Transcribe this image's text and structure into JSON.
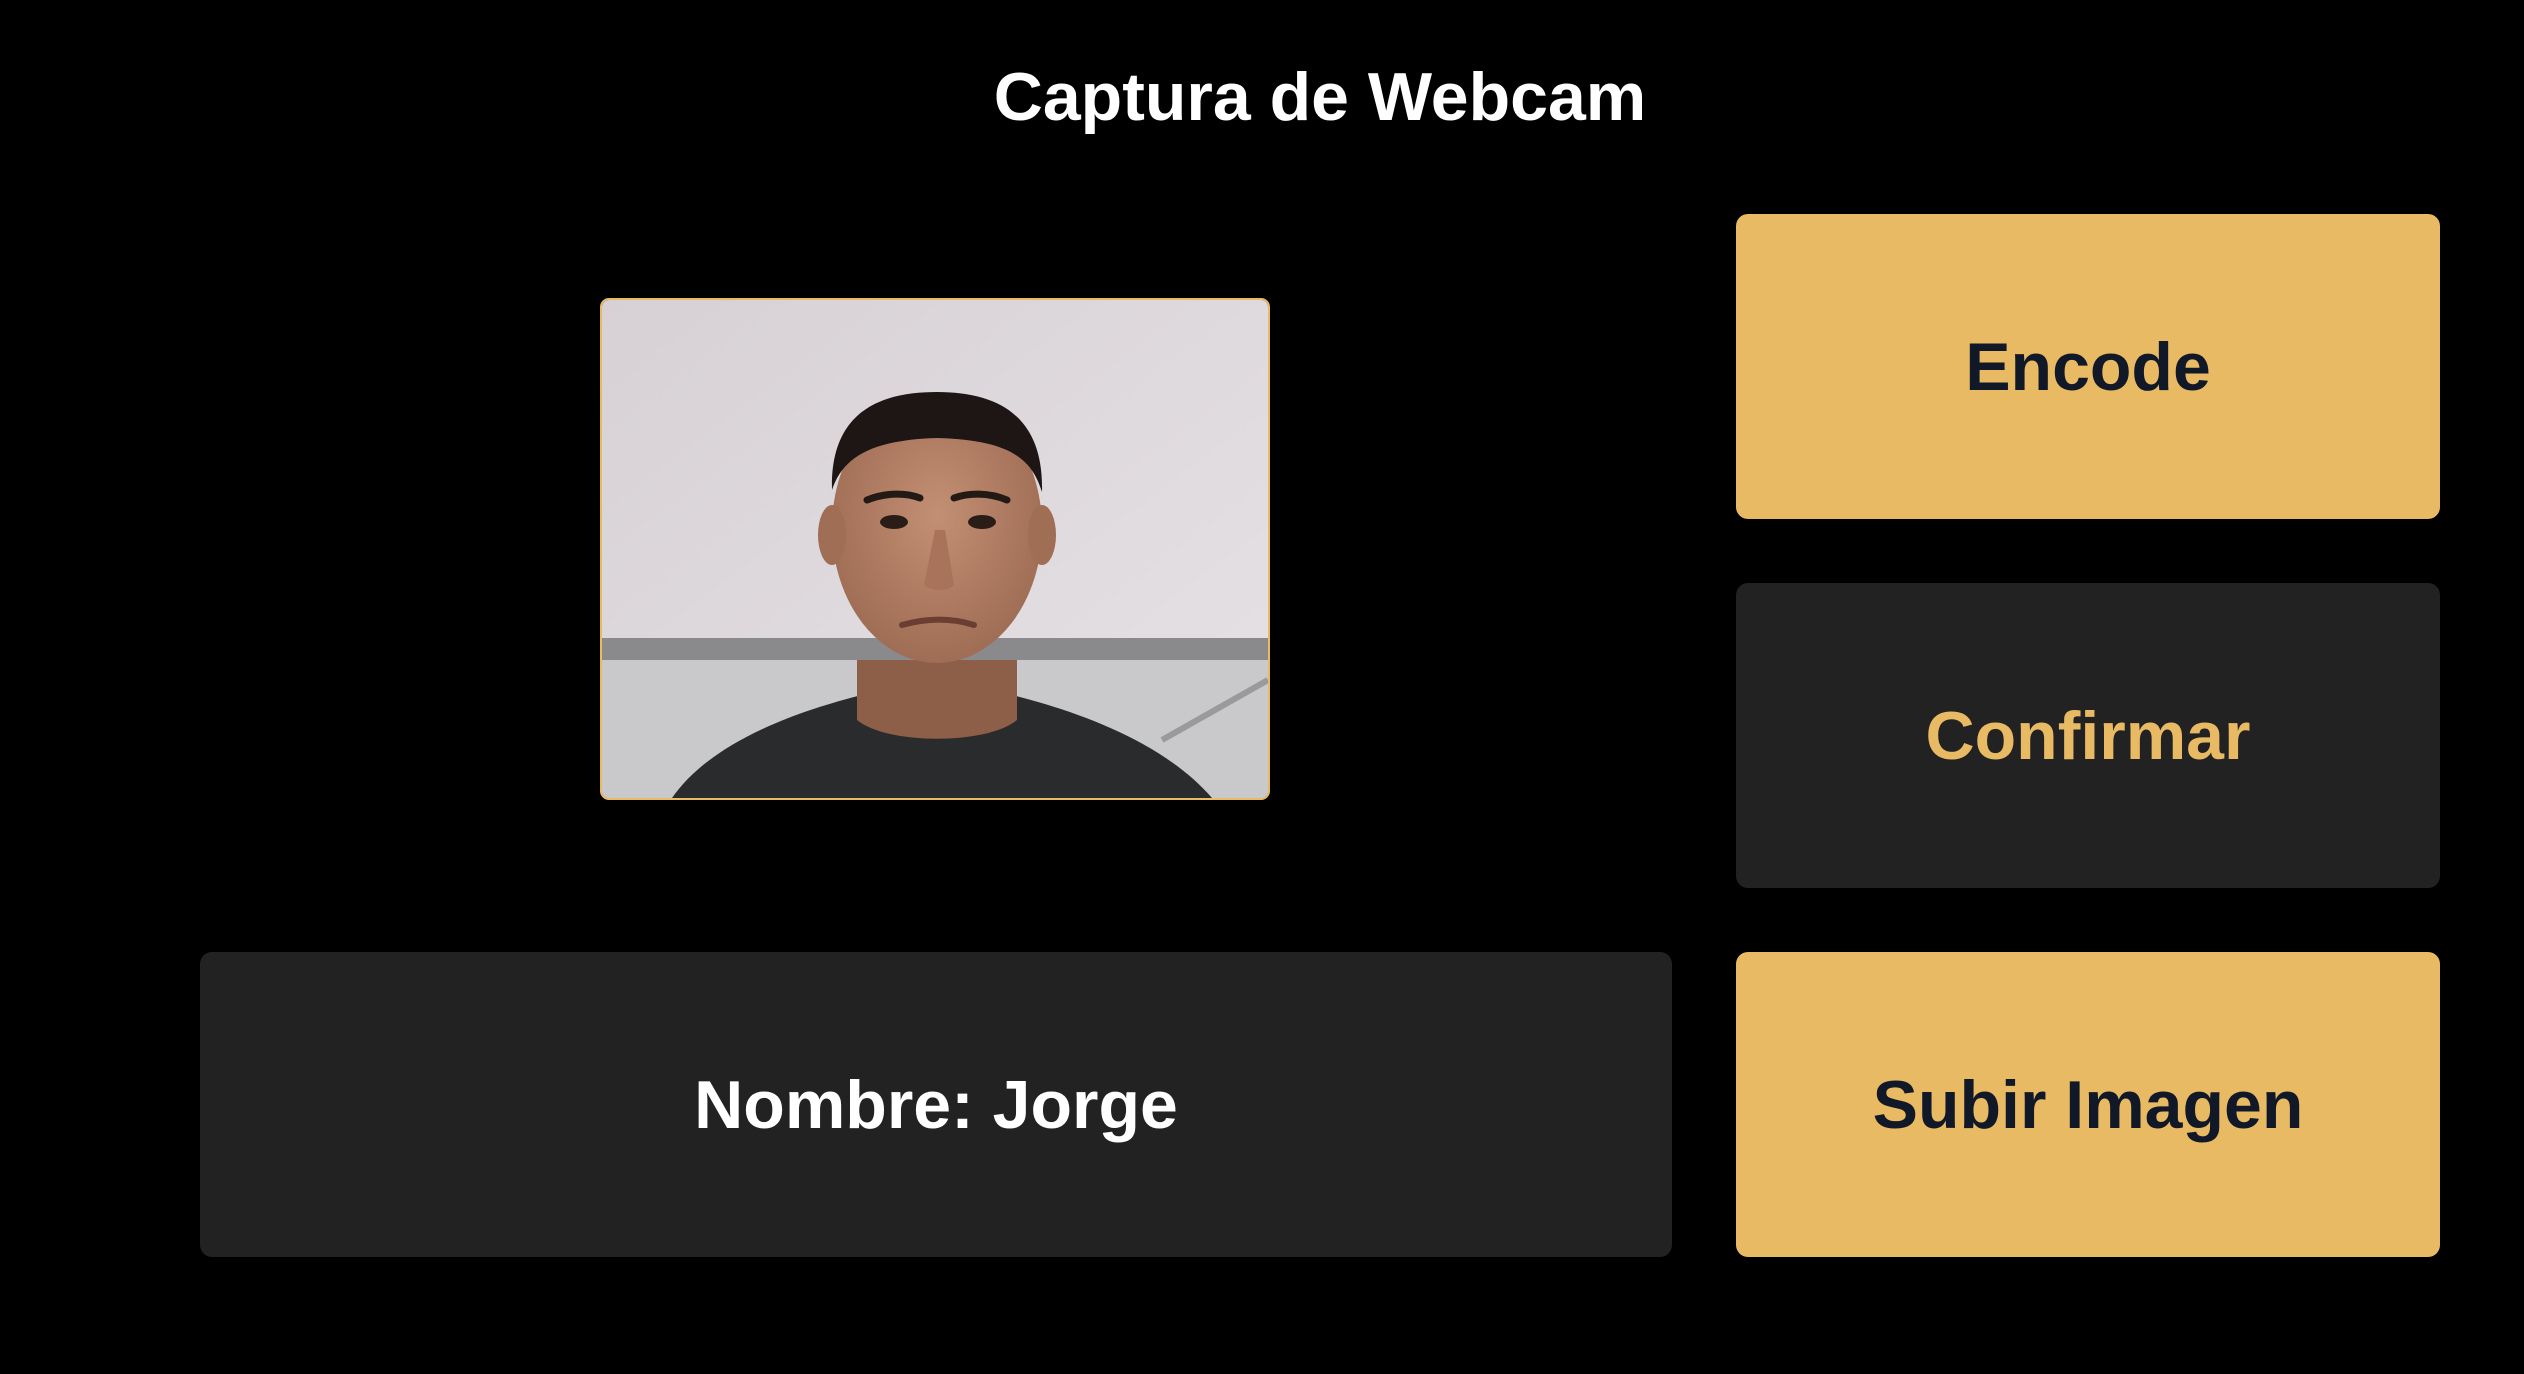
{
  "page": {
    "title": "Captura de Webcam"
  },
  "webcam": {
    "label": "webcam-preview"
  },
  "actions": {
    "encode_label": "Encode",
    "confirm_label": "Confirmar",
    "upload_label": "Subir Imagen"
  },
  "person": {
    "name_text": "Nombre: Jorge"
  },
  "colors": {
    "background": "#000000",
    "accent": "#e9ba64",
    "panel": "#222222",
    "text_light": "#ffffff",
    "text_dark": "#111827"
  }
}
